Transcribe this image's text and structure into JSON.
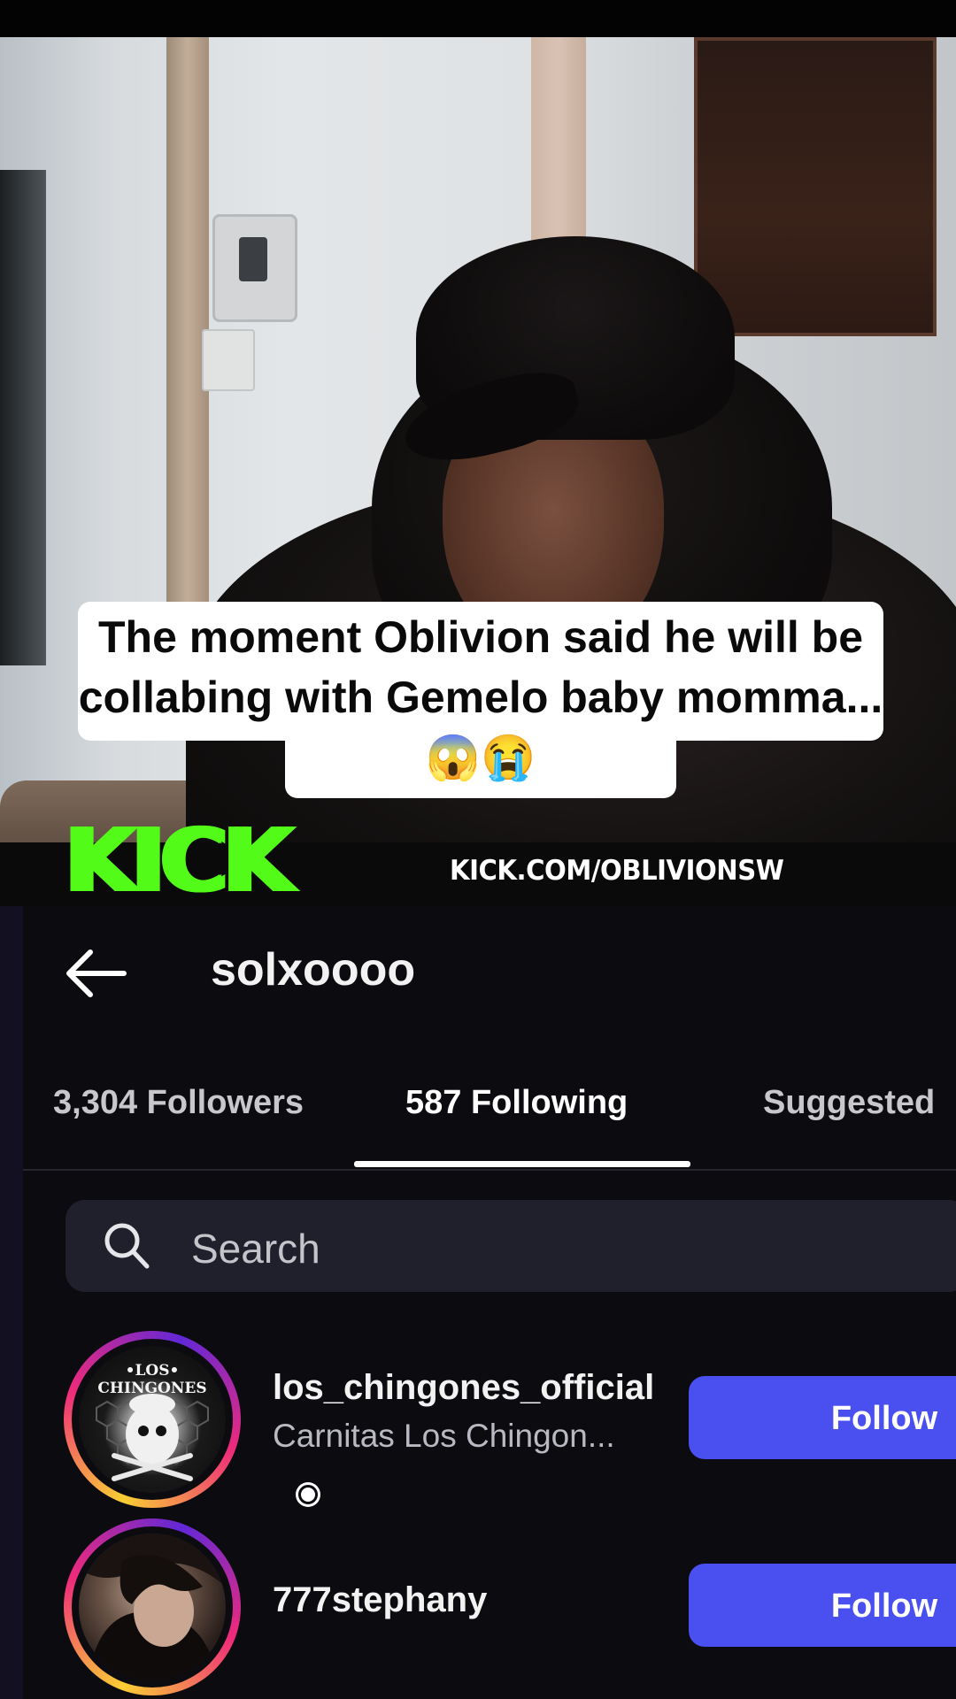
{
  "video": {
    "caption": "The moment Oblivion said he will be collabing with Gemelo baby momma...😱😭",
    "brand_logo": "KICK",
    "brand_url": "KICK.COM/OBLIVIONSW",
    "brand_color": "#53fc18"
  },
  "header": {
    "back_icon": "back-arrow-icon",
    "username": "solxoooo"
  },
  "tabs": [
    {
      "label": "3,304 Followers",
      "active": false
    },
    {
      "label": "587 Following",
      "active": true
    },
    {
      "label": "Suggested",
      "active": false
    }
  ],
  "search": {
    "icon": "search-icon",
    "placeholder": "Search"
  },
  "list": [
    {
      "username": "los_chingones_official",
      "display_name": "Carnitas Los Chingon...",
      "avatar_text": "•LOS•\nCHINGONES",
      "button": "Follow"
    },
    {
      "username": "777stephany",
      "display_name": "",
      "button": "Follow"
    }
  ],
  "colors": {
    "app_background": "#0b0b10",
    "follow_button": "#4a4ff0",
    "search_background": "#1f202b"
  }
}
